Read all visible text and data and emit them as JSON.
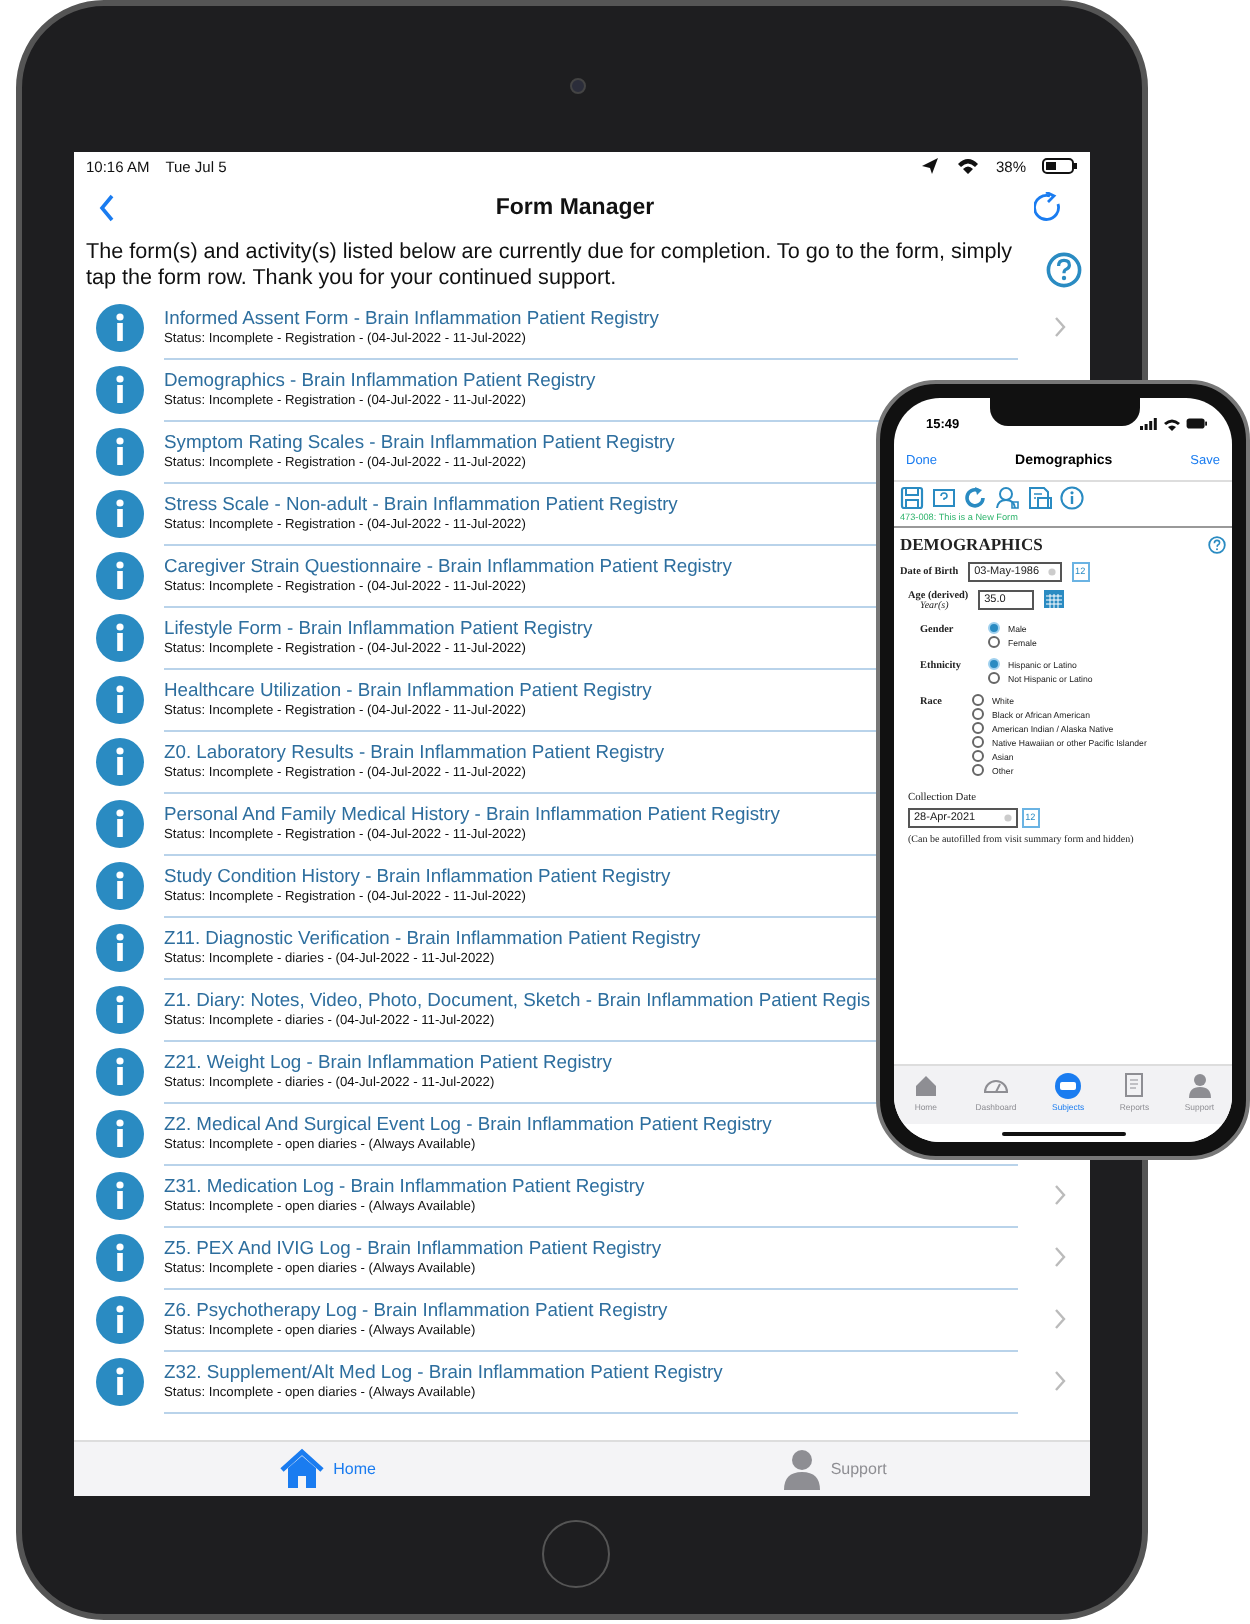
{
  "tablet": {
    "status_bar": {
      "time": "10:16 AM",
      "date": "Tue Jul 5",
      "battery": "38%"
    },
    "nav": {
      "title": "Form Manager"
    },
    "intro": "The form(s) and activity(s) listed below are currently due for completion. To go to the form, simply tap the form row. Thank you for your continued support.",
    "forms": [
      {
        "title": "Informed Assent Form - Brain Inflammation Patient Registry",
        "status": "Status: Incomplete - Registration - (04-Jul-2022 - 11-Jul-2022)",
        "chevron": true
      },
      {
        "title": "Demographics - Brain Inflammation Patient Registry",
        "status": "Status: Incomplete - Registration - (04-Jul-2022 - 11-Jul-2022)"
      },
      {
        "title": "Symptom Rating Scales - Brain Inflammation Patient Registry",
        "status": "Status: Incomplete - Registration - (04-Jul-2022 - 11-Jul-2022)"
      },
      {
        "title": "Stress Scale - Non-adult - Brain Inflammation Patient Registry",
        "status": "Status: Incomplete - Registration - (04-Jul-2022 - 11-Jul-2022)"
      },
      {
        "title": "Caregiver Strain Questionnaire - Brain Inflammation Patient Registry",
        "status": "Status: Incomplete - Registration - (04-Jul-2022 - 11-Jul-2022)"
      },
      {
        "title": "Lifestyle Form - Brain Inflammation Patient Registry",
        "status": "Status: Incomplete - Registration - (04-Jul-2022 - 11-Jul-2022)"
      },
      {
        "title": "Healthcare Utilization - Brain Inflammation Patient Registry",
        "status": "Status: Incomplete - Registration - (04-Jul-2022 - 11-Jul-2022)"
      },
      {
        "title": "Z0. Laboratory Results - Brain Inflammation Patient Registry",
        "status": "Status: Incomplete - Registration - (04-Jul-2022 - 11-Jul-2022)"
      },
      {
        "title": "Personal And Family Medical History - Brain Inflammation Patient Registry",
        "status": "Status: Incomplete - Registration - (04-Jul-2022 - 11-Jul-2022)"
      },
      {
        "title": "Study Condition History - Brain Inflammation Patient Registry",
        "status": "Status: Incomplete - Registration - (04-Jul-2022 - 11-Jul-2022)"
      },
      {
        "title": "Z11. Diagnostic Verification - Brain Inflammation Patient Registry",
        "status": "Status: Incomplete - diaries - (04-Jul-2022 - 11-Jul-2022)"
      },
      {
        "title": "Z1. Diary: Notes, Video, Photo, Document, Sketch - Brain Inflammation Patient Regis",
        "status": "Status: Incomplete - diaries - (04-Jul-2022 - 11-Jul-2022)"
      },
      {
        "title": "Z21. Weight Log - Brain Inflammation Patient Registry",
        "status": "Status: Incomplete - diaries - (04-Jul-2022 - 11-Jul-2022)"
      },
      {
        "title": "Z2. Medical And Surgical Event Log - Brain Inflammation Patient Registry",
        "status": "Status: Incomplete - open diaries - (Always Available)"
      },
      {
        "title": "Z31. Medication Log - Brain Inflammation Patient Registry",
        "status": "Status: Incomplete - open diaries - (Always Available)",
        "chevron": true
      },
      {
        "title": "Z5. PEX And IVIG Log - Brain Inflammation Patient Registry",
        "status": "Status: Incomplete - open diaries - (Always Available)",
        "chevron": true
      },
      {
        "title": "Z6. Psychotherapy Log - Brain Inflammation Patient Registry",
        "status": "Status: Incomplete - open diaries - (Always Available)",
        "chevron": true
      },
      {
        "title": "Z32. Supplement/Alt Med Log - Brain Inflammation Patient Registry",
        "status": "Status: Incomplete - open diaries - (Always Available)",
        "chevron": true
      }
    ],
    "tab_bar": [
      {
        "label": "Home",
        "selected": true
      },
      {
        "label": "Support",
        "selected": false
      }
    ]
  },
  "phone": {
    "status_bar": {
      "time": "15:49"
    },
    "nav": {
      "left": "Done",
      "title": "Demographics",
      "right": "Save"
    },
    "form_note": "473-008: This is a New Form",
    "form": {
      "heading": "DEMOGRAPHICS",
      "date_of_birth": {
        "label": "Date of Birth",
        "value": "03-May-1986",
        "calendar_day": "12"
      },
      "age": {
        "label": "Age (derived)",
        "sublabel": "Year(s)",
        "value": "35.0"
      },
      "gender": {
        "label": "Gender",
        "options": [
          {
            "label": "Male",
            "selected": true
          },
          {
            "label": "Female",
            "selected": false
          }
        ]
      },
      "ethnicity": {
        "label": "Ethnicity",
        "options": [
          {
            "label": "Hispanic or Latino",
            "selected": true
          },
          {
            "label": "Not Hispanic or Latino",
            "selected": false
          }
        ]
      },
      "race": {
        "label": "Race",
        "options": [
          {
            "label": "White",
            "selected": false
          },
          {
            "label": "Black or African American",
            "selected": false
          },
          {
            "label": "American Indian / Alaska Native",
            "selected": false
          },
          {
            "label": "Native Hawaiian or other Pacific Islander",
            "selected": false
          },
          {
            "label": "Asian",
            "selected": false
          },
          {
            "label": "Other",
            "selected": false
          }
        ]
      },
      "collection_date": {
        "label": "Collection Date",
        "value": "28-Apr-2021",
        "calendar_day": "12"
      },
      "note": "(Can be autofilled from visit summary form and hidden)"
    },
    "tab_bar": [
      {
        "label": "Home",
        "selected": false
      },
      {
        "label": "Dashboard",
        "selected": false
      },
      {
        "label": "Subjects",
        "selected": true
      },
      {
        "label": "Reports",
        "selected": false
      },
      {
        "label": "Support",
        "selected": false
      }
    ]
  }
}
